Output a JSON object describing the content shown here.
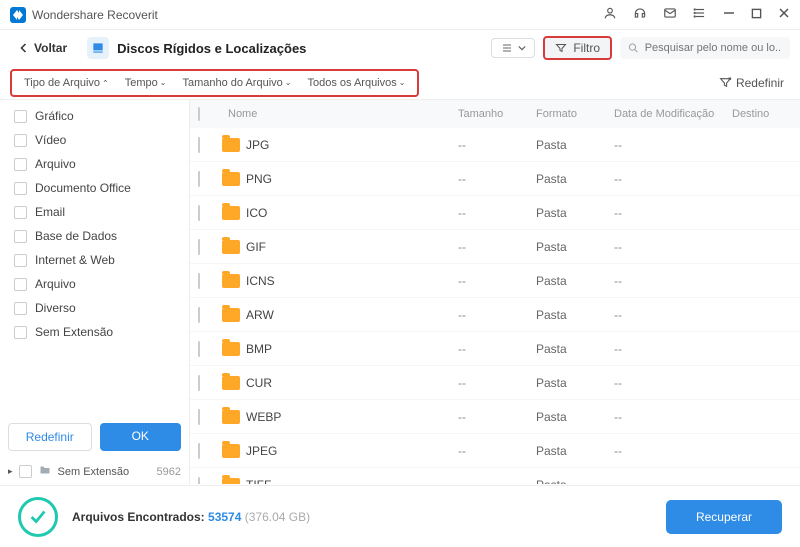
{
  "titlebar": {
    "app_name": "Wondershare Recoverit"
  },
  "toolbar": {
    "back_label": "Voltar",
    "path_title": "Discos Rígidos e Localizações",
    "filter_label": "Filtro",
    "search_placeholder": "Pesquisar pelo nome ou lo..."
  },
  "filters": {
    "chips": [
      {
        "label": "Tipo de Arquivo",
        "active": true
      },
      {
        "label": "Tempo",
        "active": false
      },
      {
        "label": "Tamanho do Arquivo",
        "active": false
      },
      {
        "label": "Todos os Arquivos",
        "active": false
      }
    ],
    "reset_label": "Redefinir"
  },
  "sidebar": {
    "categories": [
      "Gráfico",
      "Vídeo",
      "Arquivo",
      "Documento Office",
      "Email",
      "Base de Dados",
      "Internet & Web",
      "Arquivo",
      "Diverso",
      "Sem Extensão"
    ],
    "reset_label": "Redefinir",
    "ok_label": "OK",
    "tree_item": {
      "label": "Sem Extensão",
      "count": "5962"
    }
  },
  "table": {
    "headers": {
      "name": "Nome",
      "size": "Tamanho",
      "format": "Formato",
      "date": "Data de Modificação",
      "dest": "Destino"
    },
    "rows": [
      {
        "name": "JPG",
        "size": "--",
        "format": "Pasta",
        "date": "--"
      },
      {
        "name": "PNG",
        "size": "--",
        "format": "Pasta",
        "date": "--"
      },
      {
        "name": "ICO",
        "size": "--",
        "format": "Pasta",
        "date": "--"
      },
      {
        "name": "GIF",
        "size": "--",
        "format": "Pasta",
        "date": "--"
      },
      {
        "name": "ICNS",
        "size": "--",
        "format": "Pasta",
        "date": "--"
      },
      {
        "name": "ARW",
        "size": "--",
        "format": "Pasta",
        "date": "--"
      },
      {
        "name": "BMP",
        "size": "--",
        "format": "Pasta",
        "date": "--"
      },
      {
        "name": "CUR",
        "size": "--",
        "format": "Pasta",
        "date": "--"
      },
      {
        "name": "WEBP",
        "size": "--",
        "format": "Pasta",
        "date": "--"
      },
      {
        "name": "JPEG",
        "size": "--",
        "format": "Pasta",
        "date": "--"
      },
      {
        "name": "TIFF",
        "size": "--",
        "format": "Pasta",
        "date": "--"
      }
    ]
  },
  "footer": {
    "found_label": "Arquivos Encontrados:",
    "count": "53574",
    "size": "(376.04 GB)",
    "recover_label": "Recuperar"
  }
}
